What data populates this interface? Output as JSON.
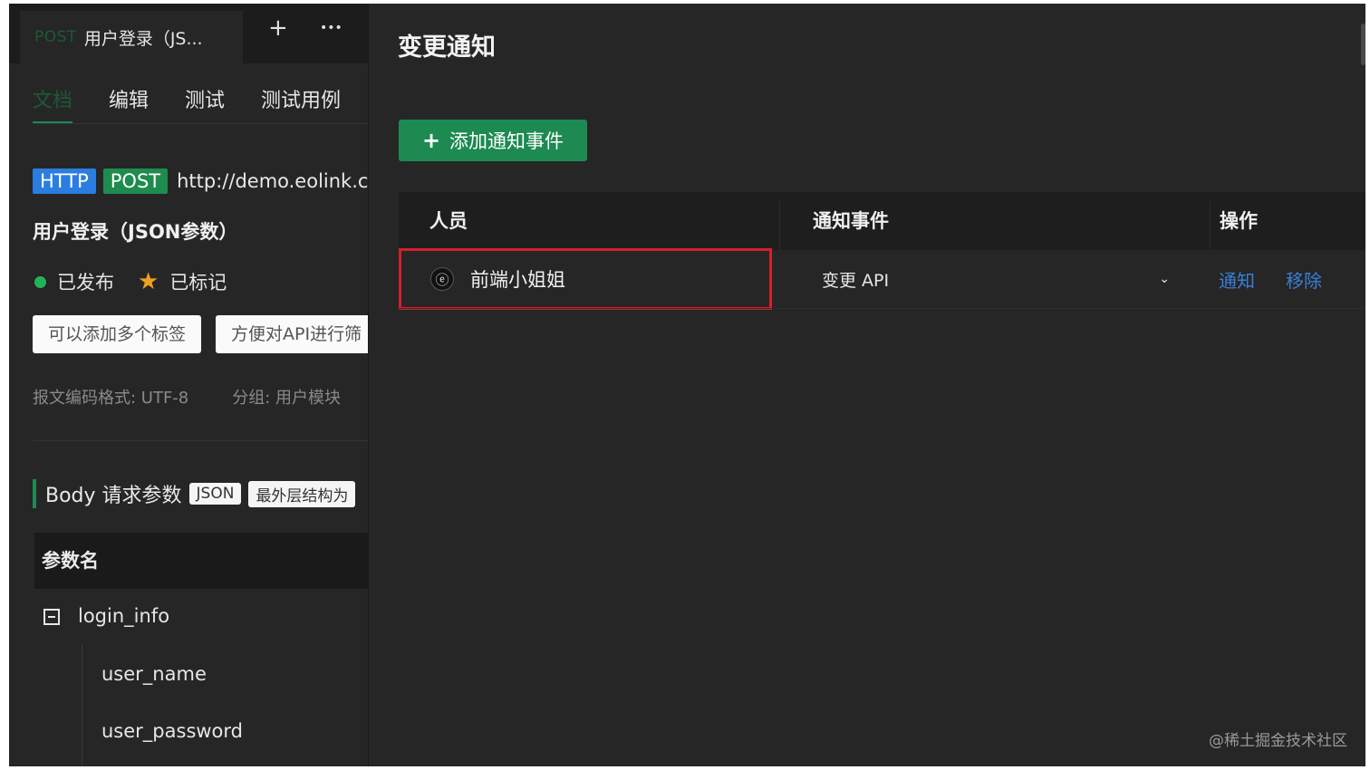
{
  "left": {
    "doc_tab": {
      "method": "POST",
      "title": "用户登录（JS..."
    },
    "tab_actions": {
      "add": "+",
      "more": "•••"
    },
    "subtabs": [
      "文档",
      "编辑",
      "测试",
      "测试用例"
    ],
    "protocol": "HTTP",
    "method": "POST",
    "url": "http://demo.eolink.c",
    "api_name": "用户登录（JSON参数）",
    "status": {
      "published": "已发布",
      "marked": "已标记"
    },
    "tags": [
      "可以添加多个标签",
      "方便对API进行筛"
    ],
    "meta": {
      "encoding": "报文编码格式: UTF-8",
      "group": "分组: 用户模块"
    },
    "body": {
      "title": "Body 请求参数",
      "format": "JSON",
      "note": "最外层结构为"
    },
    "params": {
      "header": "参数名",
      "rows": [
        "login_info",
        "user_name",
        "user_password"
      ]
    }
  },
  "right": {
    "title": "变更通知",
    "add_button": "添加通知事件",
    "table": {
      "headers": {
        "person": "人员",
        "event": "通知事件",
        "action": "操作"
      },
      "row": {
        "person": "前端小姐姐",
        "event": "变更 API",
        "actions": {
          "notify": "通知",
          "remove": "移除"
        }
      }
    }
  },
  "watermark": "@稀土掘金技术社区",
  "colors": {
    "accent_green": "#1d8a52",
    "http_blue": "#2b7de0",
    "link_blue": "#3a7fd6",
    "highlight_red": "#d4202a",
    "background": "#262626"
  },
  "icons": [
    "plus-icon",
    "more-icon",
    "star-icon",
    "collapse-icon",
    "avatar-icon",
    "chevron-down-icon"
  ]
}
